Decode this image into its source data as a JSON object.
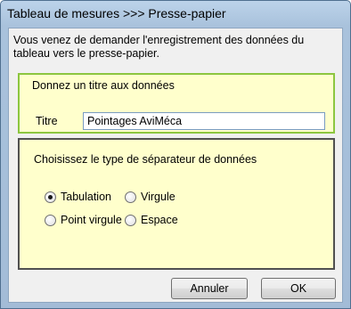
{
  "window": {
    "title": "Tableau de mesures >>> Presse-papier"
  },
  "intro_text": "Vous venez de demander l'enregistrement des données du tableau vers le presse-papier.",
  "title_group": {
    "heading": "Donnez un titre aux données",
    "field_label": "Titre",
    "field_value": "Pointages AviMéca"
  },
  "separator_group": {
    "heading": "Choisissez le type de séparateur de données",
    "options": [
      {
        "label": "Tabulation",
        "checked": true
      },
      {
        "label": "Virgule",
        "checked": false
      },
      {
        "label": "Point virgule",
        "checked": false
      },
      {
        "label": "Espace",
        "checked": false
      }
    ]
  },
  "buttons": {
    "cancel_label": "Annuler",
    "ok_label": "OK"
  },
  "colors": {
    "group_background": "#ffffcc",
    "title_group_border": "#8cc63f",
    "separator_group_border": "#505050",
    "window_frame": "#a9c2dc"
  }
}
